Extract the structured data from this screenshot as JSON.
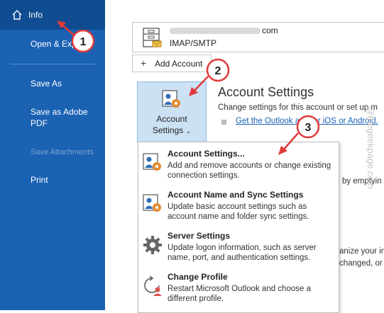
{
  "sidebar": {
    "info_label": "Info",
    "open_export": "Open & Export",
    "save_as": "Save As",
    "save_adobe_line1": "Save as Adobe",
    "save_adobe_line2": "PDF",
    "save_attachments": "Save Attachments",
    "print": "Print"
  },
  "account": {
    "email_suffix": "com",
    "type": "IMAP/SMTP",
    "add_account": "Add Account"
  },
  "account_settings": {
    "button_line1": "Account",
    "button_line2": "Settings",
    "title": "Account Settings",
    "description": "Change settings for this account or set up m",
    "link": "Get the Outlook app for iOS or Android."
  },
  "background_fragments": {
    "empty": "by emptyin",
    "organize": "anize your in",
    "changed": "changed, or"
  },
  "menu": {
    "items": [
      {
        "title": "Account Settings...",
        "desc": "Add and remove accounts or change existing connection settings."
      },
      {
        "title": "Account Name and Sync Settings",
        "desc": "Update basic account settings such as account name and folder sync settings."
      },
      {
        "title": "Server Settings",
        "desc": "Update logon information, such as server name, port, and authentication settings."
      },
      {
        "title": "Change Profile",
        "desc": "Restart Microsoft Outlook and choose a different profile."
      }
    ]
  },
  "callouts": [
    "1",
    "2",
    "3"
  ],
  "watermark": "@thegeekpage.com",
  "colors": {
    "sidebar": "#1b62b3",
    "sidebar_active": "#0f4c91",
    "button_bg": "#cde1f5",
    "callout": "#e03a3a",
    "link": "#1b62b3"
  }
}
